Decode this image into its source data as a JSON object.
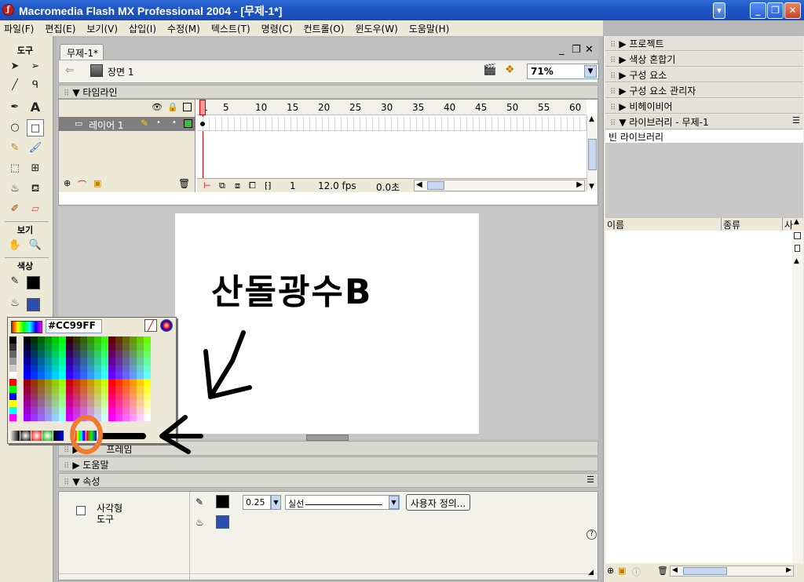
{
  "window": {
    "title": "Macromedia Flash MX Professional 2004 - [무제-1*]",
    "app_icon": "flash-logo-icon",
    "controls": [
      "minimize",
      "restore",
      "close"
    ]
  },
  "menubar": {
    "items": [
      "파일(F)",
      "편집(E)",
      "보기(V)",
      "삽입(I)",
      "수정(M)",
      "텍스트(T)",
      "명령(C)",
      "컨트롤(O)",
      "윈도우(W)",
      "도움말(H)"
    ]
  },
  "toolbox": {
    "tools_label": "도구",
    "view_label": "보기",
    "colors_label": "색상",
    "stroke_color": "#000000",
    "fill_color": "#2a4fb0",
    "tools": [
      "arrow",
      "subselect",
      "line",
      "lasso",
      "pen",
      "text",
      "oval",
      "rectangle",
      "pencil",
      "brush",
      "free-transform",
      "fill-transform",
      "ink-bottle",
      "paint-bucket",
      "eyedropper",
      "eraser"
    ]
  },
  "document": {
    "tab_label": "무제-1*",
    "scene_label": "장면 1",
    "zoom": "71%"
  },
  "timeline": {
    "header": "타임라인",
    "layer_name": "레이어 1",
    "frame_numbers": [
      "1",
      "5",
      "10",
      "15",
      "20",
      "25",
      "30",
      "35",
      "40",
      "45",
      "50",
      "55",
      "60"
    ],
    "current_frame": "1",
    "fps": "12.0 fps",
    "elapsed": "0.0초"
  },
  "stage": {
    "handwritten_text": "산돌광수B"
  },
  "color_popup": {
    "hex_value": "#CC99FF",
    "accent": "#cc99ff"
  },
  "panels": {
    "frame": "프레임",
    "help": "도움말",
    "properties": "속성"
  },
  "properties": {
    "tool_name_line1": "사각형",
    "tool_name_line2": "도구",
    "stroke_height": "0.25",
    "stroke_style": "실선",
    "custom_button": "사용자 정의..."
  },
  "right_panels": {
    "project": "프로젝트",
    "color_mixer": "색상 혼합기",
    "components": "구성 요소",
    "component_inspector": "구성 요소 관리자",
    "behaviors": "비헤이비어",
    "library_title": "라이브러리 - 무제-1",
    "library_empty": "빈 라이브러리",
    "columns": [
      "이름",
      "종류",
      "사"
    ]
  },
  "annotation": {
    "circle_color": "#f07a30",
    "arrow_color": "#000000"
  }
}
